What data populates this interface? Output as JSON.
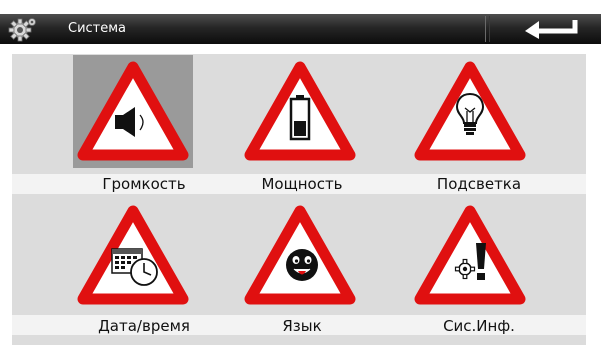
{
  "header": {
    "title": "Система",
    "settings_icon": "gear-icon",
    "back_icon": "back-arrow-icon"
  },
  "menu": {
    "items": [
      {
        "label": "Громкость",
        "icon": "speaker-icon",
        "selected": true
      },
      {
        "label": "Мощность",
        "icon": "battery-icon",
        "selected": false
      },
      {
        "label": "Подсветка",
        "icon": "lightbulb-icon",
        "selected": false
      },
      {
        "label": "Дата/время",
        "icon": "calendar-clock-icon",
        "selected": false
      },
      {
        "label": "Язык",
        "icon": "smiley-face-icon",
        "selected": false
      },
      {
        "label": "Сис.Инф.",
        "icon": "gear-exclamation-icon",
        "selected": false
      }
    ]
  },
  "colors": {
    "accent": "#e01010",
    "title_bar": "#1a1a1a",
    "panel": "#dcdcdc",
    "selected_tile": "#9a9a9a"
  }
}
